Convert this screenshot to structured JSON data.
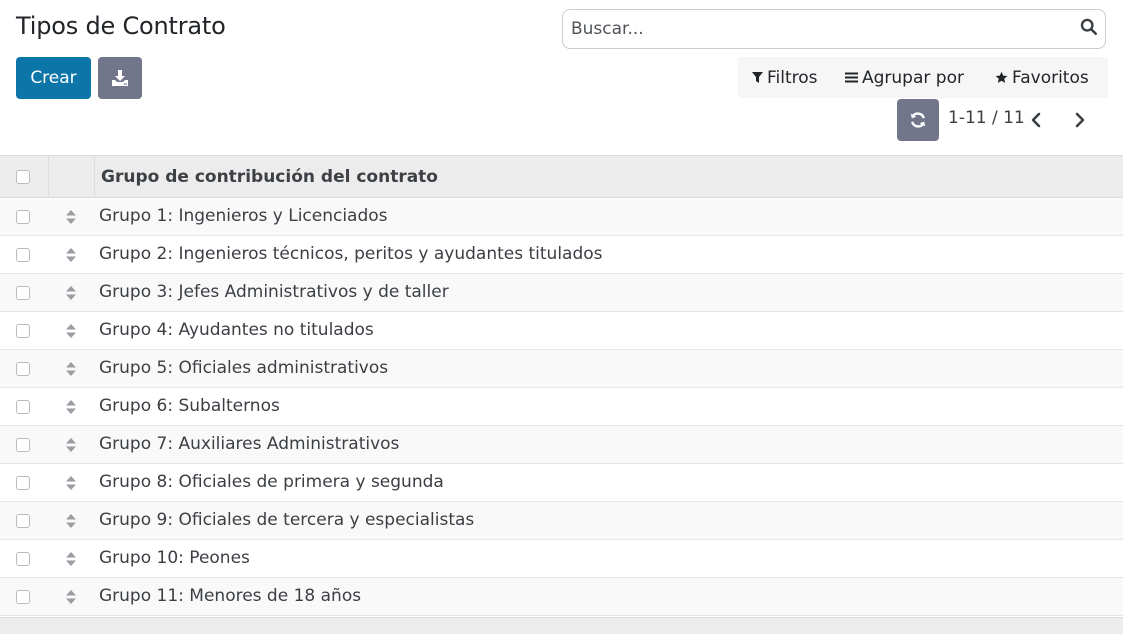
{
  "page": {
    "title": "Tipos de Contrato"
  },
  "search": {
    "placeholder": "Buscar...",
    "value": ""
  },
  "buttons": {
    "create_label": "Crear"
  },
  "filters": {
    "filters_label": "Filtros",
    "group_by_label": "Agrupar por",
    "favorites_label": "Favoritos"
  },
  "pager": {
    "value": "1-11 / 11"
  },
  "table": {
    "column_header": "Grupo de contribución del contrato",
    "rows": [
      "Grupo 1: Ingenieros y Licenciados",
      "Grupo 2: Ingenieros técnicos, peritos y ayudantes titulados",
      "Grupo 3: Jefes Administrativos y de taller",
      "Grupo 4: Ayudantes no titulados",
      "Grupo 5: Oficiales administrativos",
      "Grupo 6: Subalternos",
      "Grupo 7: Auxiliares Administrativos",
      "Grupo 8: Oficiales de primera y segunda",
      "Grupo 9: Oficiales de tercera y especialistas",
      "Grupo 10: Peones",
      "Grupo 11: Menores de 18 años"
    ]
  },
  "colors": {
    "primary": "#0d76a8",
    "secondary": "#71768b"
  },
  "icons": {
    "search": "search-icon",
    "download": "download-icon",
    "filter": "filter-icon",
    "group_by": "bars-icon",
    "favorites": "star-icon",
    "refresh": "refresh-icon",
    "prev": "chevron-left-icon",
    "next": "chevron-right-icon",
    "handle": "sort-handle-icon"
  }
}
